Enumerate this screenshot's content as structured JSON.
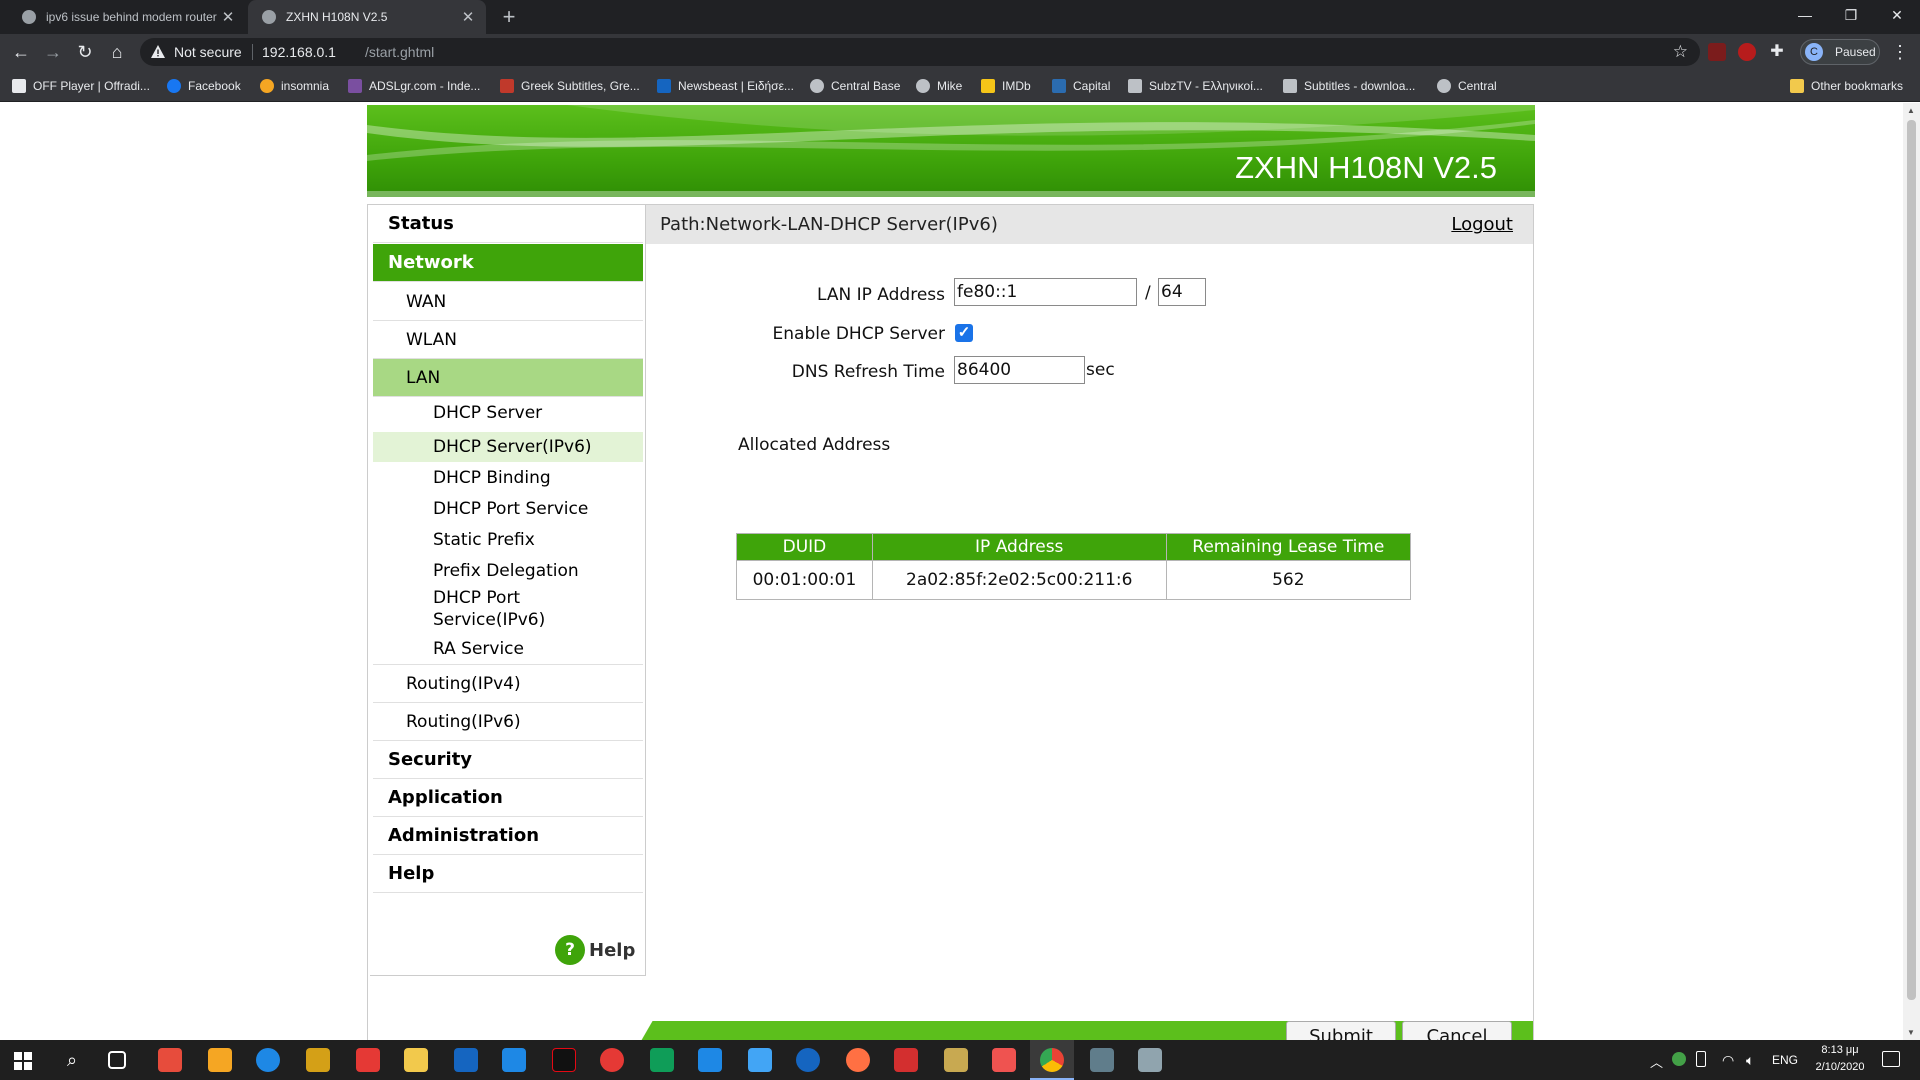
{
  "browser": {
    "tabs": [
      {
        "title": "ipv6 issue behind modem router"
      },
      {
        "title": "ZXHN H108N V2.5"
      }
    ],
    "security_label": "Not secure",
    "url_host": "192.168.0.1",
    "url_path": "/start.ghtml",
    "profile_initial": "C",
    "profile_label": "Paused",
    "bookmarks": [
      {
        "label": "OFF Player | Offradi...",
        "icon": "radio-icon",
        "color": "#e8eaed"
      },
      {
        "label": "Facebook",
        "icon": "facebook-icon",
        "color": "#1877f2"
      },
      {
        "label": "insomnia",
        "icon": "insomnia-icon",
        "color": "#f5a623"
      },
      {
        "label": "ADSLgr.com - Inde...",
        "icon": "adslgr-icon",
        "color": "#7a4fa0"
      },
      {
        "label": "Greek Subtitles, Gre...",
        "icon": "subs-icon",
        "color": "#c0392b"
      },
      {
        "label": "Newsbeast | Ειδήσε...",
        "icon": "newsbeast-icon",
        "color": "#1565c0"
      },
      {
        "label": "Central Base",
        "icon": "globe-icon",
        "color": "#bdc1c6"
      },
      {
        "label": "Mike",
        "icon": "globe-icon",
        "color": "#bdc1c6"
      },
      {
        "label": "IMDb",
        "icon": "imdb-icon",
        "color": "#f5c518"
      },
      {
        "label": "Capital",
        "icon": "capital-icon",
        "color": "#2b6cb0"
      },
      {
        "label": "SubzTV - Ελληνικοί...",
        "icon": "subztv-icon",
        "color": "#bdc1c6"
      },
      {
        "label": "Subtitles - downloa...",
        "icon": "opensubs-icon",
        "color": "#bdc1c6"
      },
      {
        "label": "Central",
        "icon": "globe-icon",
        "color": "#bdc1c6"
      }
    ],
    "other_bookmarks": "Other bookmarks"
  },
  "router": {
    "model": "ZXHN H108N V2.5",
    "accent_color": "#3fa40a",
    "path": "Path:Network-LAN-DHCP Server(IPv6)",
    "logout": "Logout",
    "menu": {
      "status": "Status",
      "network": "Network",
      "wan": "WAN",
      "wlan": "WLAN",
      "lan": "LAN",
      "lan_items": [
        "DHCP Server",
        "DHCP Server(IPv6)",
        "DHCP Binding",
        "DHCP Port Service",
        "Static Prefix",
        "Prefix Delegation"
      ],
      "dhcp_port_service_ipv6_a": "DHCP Port",
      "dhcp_port_service_ipv6_b": "Service(IPv6)",
      "ra_service": "RA Service",
      "routing_ipv4": "Routing(IPv4)",
      "routing_ipv6": "Routing(IPv6)",
      "security": "Security",
      "application": "Application",
      "administration": "Administration",
      "help": "Help"
    },
    "help_label": "Help",
    "form": {
      "lan_ip_label": "LAN IP Address",
      "lan_ip_value": "fe80::1",
      "slash": "/",
      "prefix_value": "64",
      "enable_dhcp_label": "Enable DHCP Server",
      "enable_dhcp_checked": true,
      "dns_refresh_label": "DNS Refresh Time",
      "dns_refresh_value": "86400",
      "dns_refresh_unit": "sec"
    },
    "allocated": {
      "title": "Allocated Address",
      "columns": [
        "DUID",
        "IP Address",
        "Remaining Lease Time"
      ],
      "rows": [
        [
          "00:01:00:01",
          "2a02:85f:2e02:5c00:211:6",
          "562"
        ]
      ]
    },
    "buttons": {
      "submit": "Submit",
      "cancel": "Cancel"
    }
  },
  "taskbar": {
    "language": "ENG",
    "time": "8:13 μμ",
    "date": "2/10/2020"
  }
}
